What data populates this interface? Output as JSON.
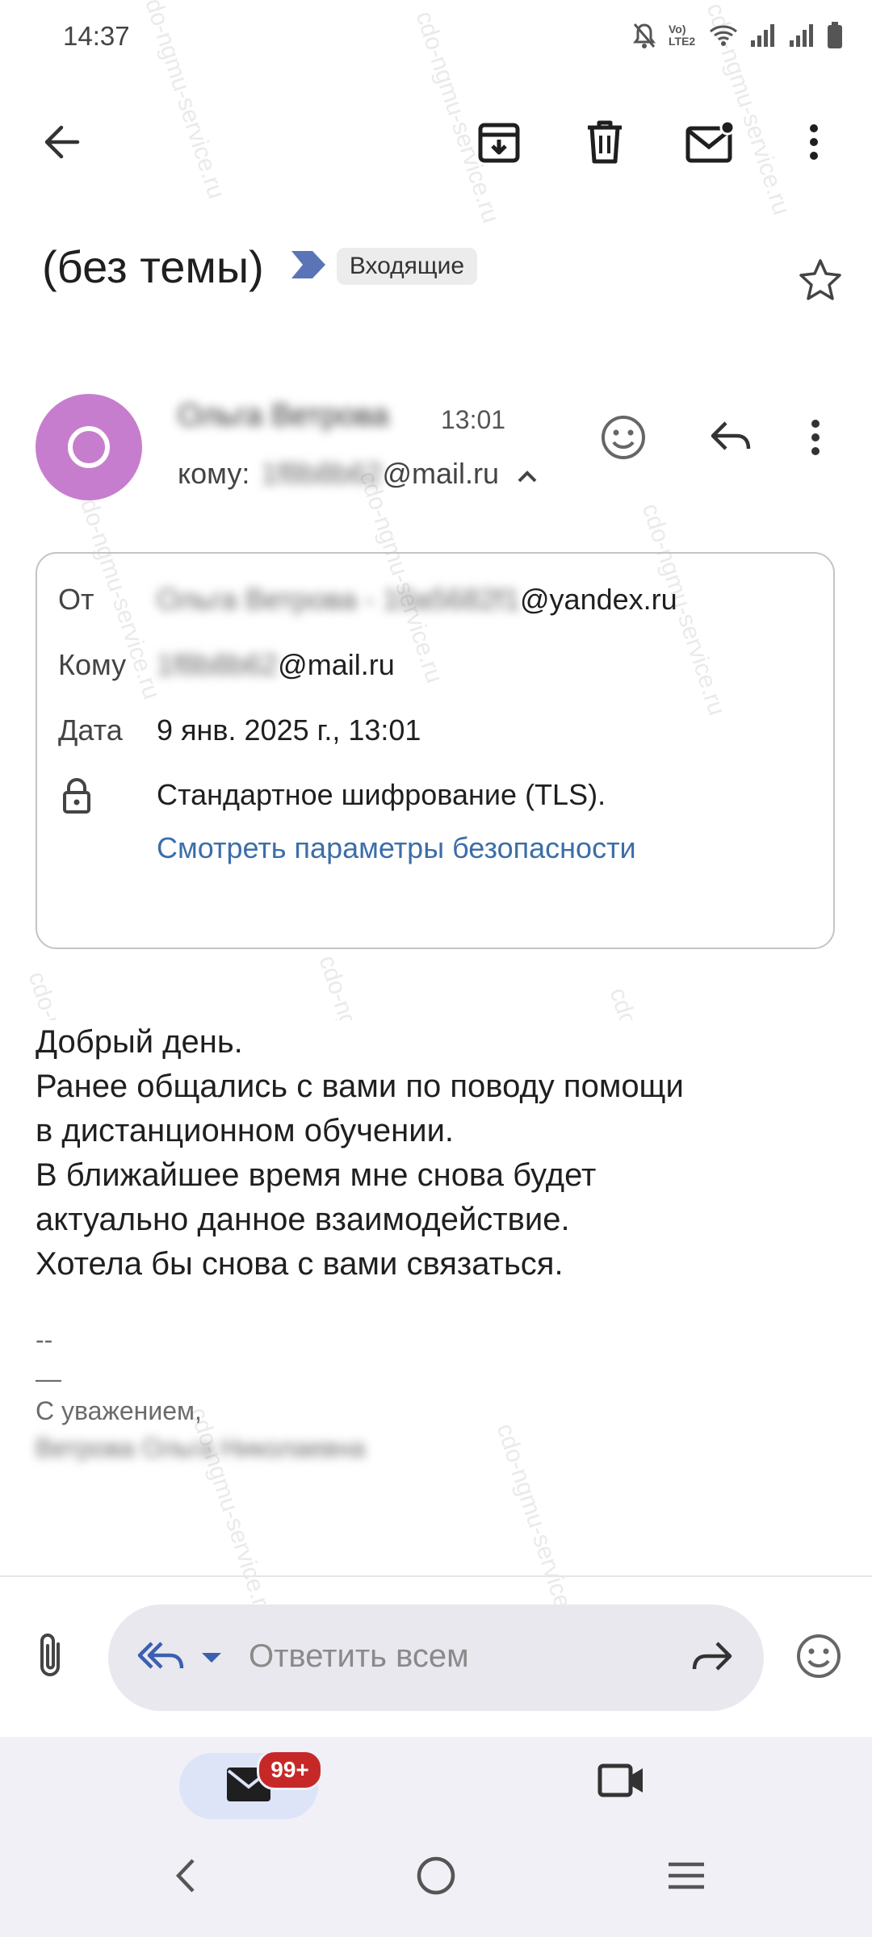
{
  "status_bar": {
    "time": "14:37",
    "icons": [
      "mute-bell-icon",
      "volte-icon",
      "wifi-icon",
      "signal-icon",
      "signal-icon",
      "battery-icon"
    ],
    "volte_label": "Vo) LTE2"
  },
  "toolbar": {
    "icons": [
      "back-arrow-icon",
      "archive-icon",
      "trash-icon",
      "mark-unread-icon",
      "more-vertical-icon"
    ]
  },
  "email": {
    "subject": "(без темы)",
    "label": "Входящие",
    "sender_name": "Ольга Ветрова",
    "time": "13:01",
    "to_prefix": "кому:",
    "to_hidden": "1f8b8b62",
    "to_domain": "@mail.ru"
  },
  "details": {
    "from_label": "От",
    "from_hidden": "Ольга Ветрова - 10a5682f1",
    "from_domain": "@yandex.ru",
    "to_label": "Кому",
    "to_hidden": "1f8b8b62",
    "to_domain": "@mail.ru",
    "date_label": "Дата",
    "date_value": "9 янв. 2025 г., 13:01",
    "encryption": "Стандартное шифрование (TLS).",
    "security_link": "Смотреть параметры безопасности"
  },
  "body": {
    "lines": [
      "Добрый день.",
      "Ранее общались с вами по поводу помощи",
      "в дистанционном обучении.",
      "В ближайшее время мне снова будет",
      "актуально данное взаимодействие.",
      "Хотела бы снова с вами связаться."
    ],
    "sig_dashes1": "--",
    "sig_dashes2": "—",
    "regards": "С уважением,",
    "sig_name": "Ветрова Ольга Николаевна"
  },
  "reply": {
    "placeholder": "Ответить всем"
  },
  "bottom_nav": {
    "badge": "99+"
  },
  "watermark": "cdo-ngmu-service.ru",
  "colors": {
    "avatar": "#c77dce",
    "link": "#3c6ea8",
    "badge": "#c62828",
    "label_arrow": "#5b74b8"
  }
}
